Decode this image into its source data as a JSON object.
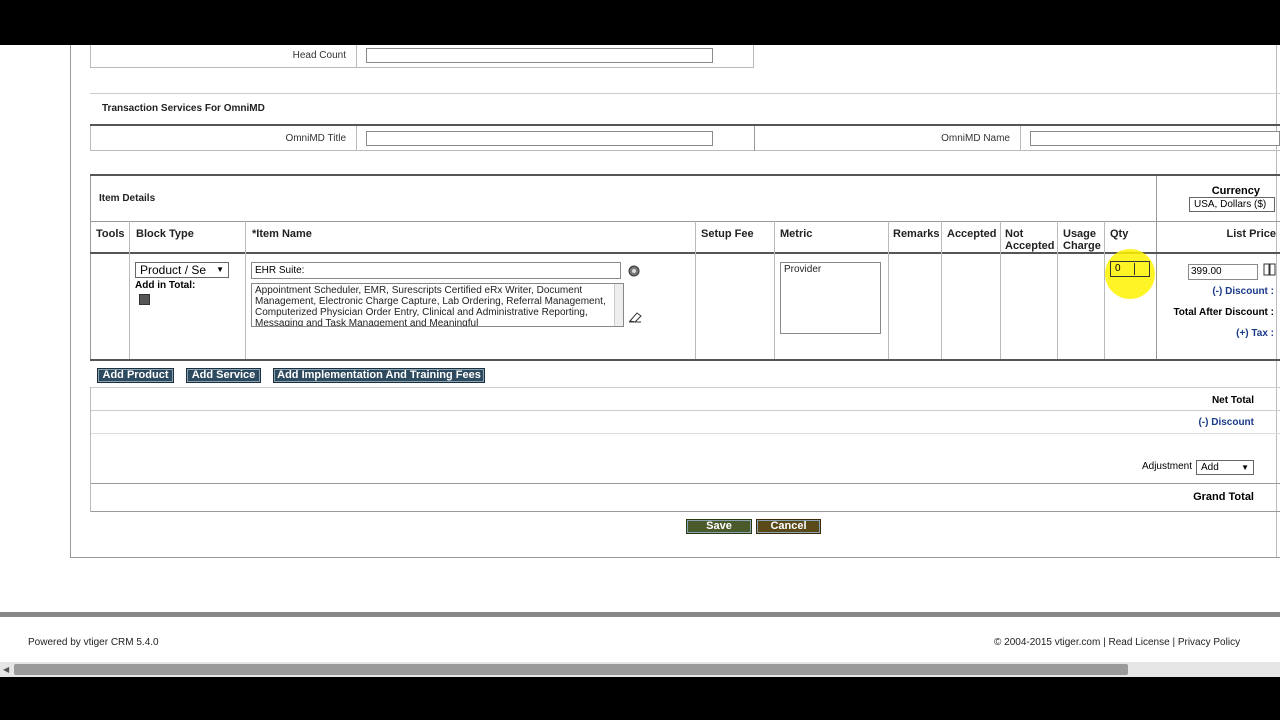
{
  "head_count": {
    "label": "Head Count",
    "value": ""
  },
  "transaction": {
    "title": "Transaction Services For OmniMD",
    "omnimd_title_label": "OmniMD Title",
    "omnimd_title_value": "",
    "omnimd_name_label": "OmniMD Name",
    "omnimd_name_value": ""
  },
  "items": {
    "section_title": "Item Details",
    "currency_label": "Currency",
    "currency_value": "USA, Dollars ($)",
    "columns": {
      "tools": "Tools",
      "block_type": "Block Type",
      "item_name": "*Item Name",
      "setup_fee": "Setup Fee",
      "metric": "Metric",
      "remarks": "Remarks",
      "accepted": "Accepted",
      "not_accepted_1": "Not",
      "not_accepted_2": "Accepted",
      "usage_charge_1": "Usage",
      "usage_charge_2": "Charge",
      "qty": "Qty",
      "list_price": "List Price"
    },
    "row": {
      "block_type": "Product / Se",
      "add_in_total": "Add in Total:",
      "item_name": "EHR Suite:",
      "description": "Appointment Scheduler, EMR, Surescripts Certified eRx Writer, Document Management, Electronic Charge Capture, Lab Ordering, Referral Management, Computerized Physician Order Entry, Clinical and Administrative Reporting, Messaging and Task Management and Meaningful",
      "metric": "Provider",
      "qty": "0",
      "list_price": "399.00",
      "discount": "(-) Discount :",
      "total_after_discount": "Total After Discount :",
      "tax": "(+) Tax :"
    },
    "buttons": {
      "add_product": "Add Product",
      "add_service": "Add Service",
      "add_impl": "Add Implementation And Training Fees"
    },
    "totals": {
      "net_total": "Net Total",
      "discount": "(-) Discount",
      "adjustment_label": "Adjustment",
      "adjustment_value": "Add",
      "grand_total": "Grand Total"
    }
  },
  "actions": {
    "save": "Save",
    "cancel": "Cancel"
  },
  "footer": {
    "powered": "Powered by vtiger CRM 5.4.0",
    "copyright": "© 2004-2015 vtiger.com",
    "read_license": "Read License",
    "privacy_policy": "Privacy Policy",
    "sep": "|"
  },
  "colors": {
    "button": "#2e4a5e",
    "cancel": "#5a4a1a",
    "save": "#4a5a2a",
    "highlight": "#fff200"
  }
}
